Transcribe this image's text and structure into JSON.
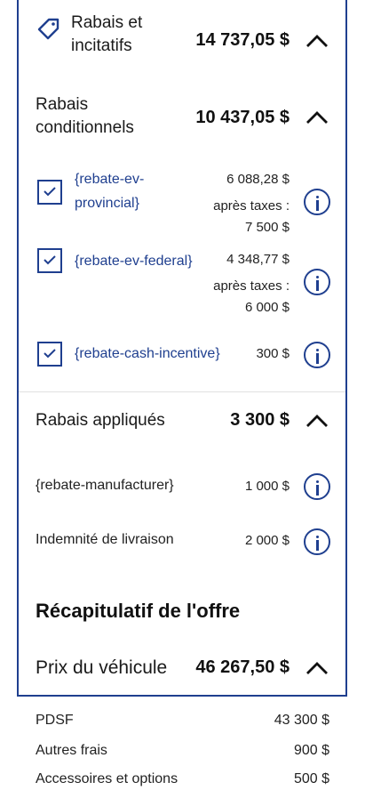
{
  "rebates_incentives": {
    "label": "Rabais et incitatifs",
    "amount": "14 737,05 $"
  },
  "conditional": {
    "label": "Rabais conditionnels",
    "amount": "10 437,05 $",
    "items": [
      {
        "name": "{rebate-ev-provincial}",
        "amount": "6 088,28 $",
        "after_tax_label": "après taxes :",
        "after_tax_amount": "7 500 $",
        "checked": true
      },
      {
        "name": "{rebate-ev-federal}",
        "amount": "4 348,77 $",
        "after_tax_label": "après taxes :",
        "after_tax_amount": "6 000 $",
        "checked": true
      },
      {
        "name": "{rebate-cash-incentive}",
        "amount": "300 $",
        "checked": true
      }
    ]
  },
  "applied": {
    "label": "Rabais appliqués",
    "amount": "3 300 $",
    "items": [
      {
        "name": "{rebate-manufacturer}",
        "amount": "1 000 $"
      },
      {
        "name": "Indemnité de livraison",
        "amount": "2 000 $"
      }
    ]
  },
  "recap": {
    "title": "Récapitulatif de l'offre",
    "vehicle_price_label": "Prix du véhicule",
    "vehicle_price_amount": "46 267,50 $",
    "rows": [
      {
        "label": "PDSF",
        "amount": "43 300 $"
      },
      {
        "label": "Autres frais",
        "amount": "900 $"
      },
      {
        "label": "Accessoires et options",
        "amount": "500 $"
      }
    ]
  },
  "colors": {
    "accent": "#1f3f8f",
    "divider": "#e1e1e1"
  },
  "icons": {
    "tag": "tag-icon",
    "chevron": "chevron-up-icon",
    "info": "info-icon",
    "check": "check-icon"
  }
}
